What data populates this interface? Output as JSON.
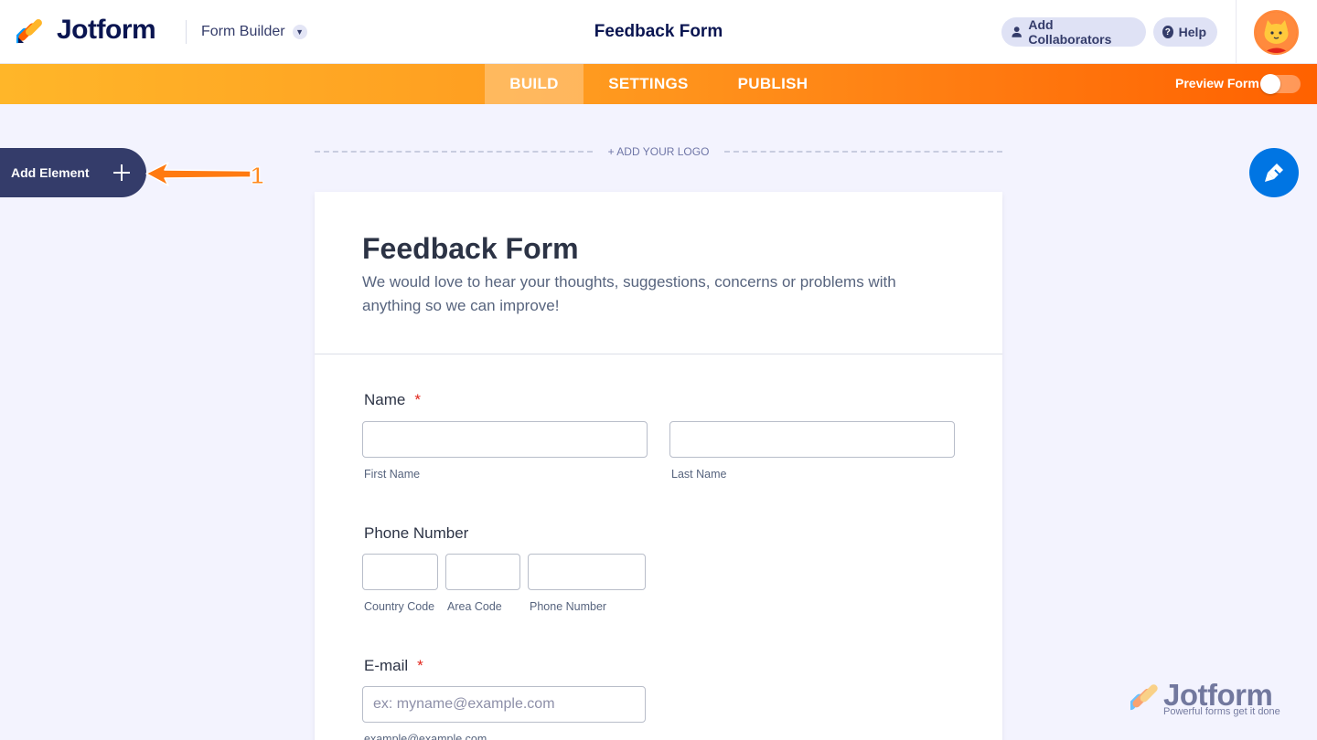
{
  "header": {
    "brand": "Jotform",
    "mode": "Form Builder",
    "title": "Feedback Form",
    "add_collaborators": "Add Collaborators",
    "help": "Help"
  },
  "nav": {
    "tabs": [
      {
        "label": "BUILD",
        "active": true
      },
      {
        "label": "SETTINGS",
        "active": false
      },
      {
        "label": "PUBLISH",
        "active": false
      }
    ],
    "preview_label": "Preview Form",
    "preview_on": false
  },
  "sidebar": {
    "add_element": "Add Element",
    "annotation_number": "1"
  },
  "canvas": {
    "add_logo": "+ ADD YOUR LOGO"
  },
  "form": {
    "title": "Feedback Form",
    "description": "We would love to hear your thoughts, suggestions, concerns or problems with anything so we can improve!",
    "name": {
      "label": "Name",
      "required": "*",
      "first_sub": "First Name",
      "last_sub": "Last Name"
    },
    "phone": {
      "label": "Phone Number",
      "country_sub": "Country Code",
      "area_sub": "Area Code",
      "number_sub": "Phone Number"
    },
    "email": {
      "label": "E-mail",
      "required": "*",
      "placeholder": "ex: myname@example.com",
      "sub": "example@example.com"
    }
  },
  "watermark": {
    "brand": "Jotform",
    "tagline": "Powerful forms get it done"
  },
  "colors": {
    "brand_navy": "#0a1551",
    "accent_orange": "#ff6100",
    "accent_blue": "#0075e3",
    "required_red": "#e1251b"
  },
  "icons": {
    "collaborators": "user-icon",
    "help": "question-icon",
    "designer": "paint-brush-icon",
    "add": "plus-icon"
  }
}
